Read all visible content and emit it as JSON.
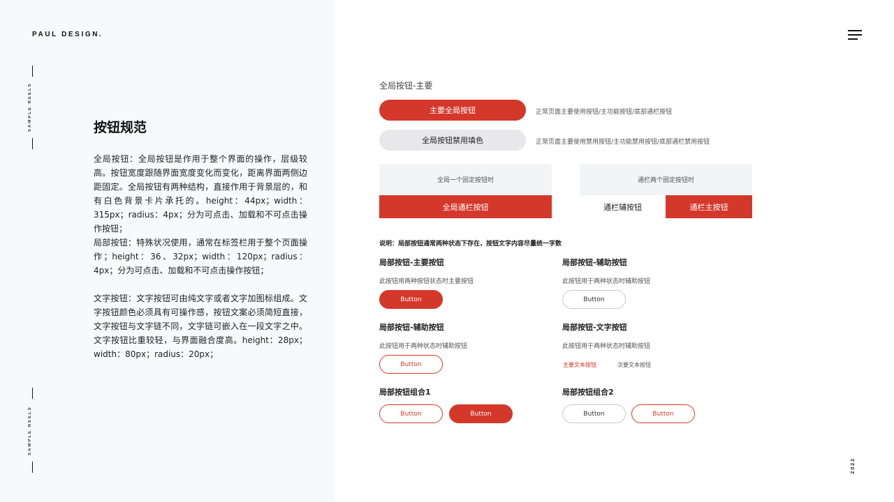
{
  "brand": "PAUL DESIGN.",
  "reel_text": "SAMPLE REELS",
  "year": "2022",
  "left": {
    "title": "按钮规范",
    "paragraphs": [
      "全局按钮：全局按钮是作用于整个界面的操作，层级较高。按钮宽度跟随界面宽度变化而变化，距离界面两侧边距固定。全局按钮有两种结构，直接作用于背景层的，和有白色背景卡片承托的。height：44px；width：315px；radius：4px；分为可点击、加载和不可点击操作按钮；",
      "局部按钮：特殊状况使用，通常在标签栏用于整个页面操作；height：36、32px；width：120px；radius：4px；分为可点击、加载和不可点击操作按钮；",
      "文字按钮：文字按钮可由纯文字或者文字加图标组成。文字按钮颜色必须具有可操作感，按钮文案必须简短直接，文字按钮与文字链不同，文字链可嵌入在一段文字之中。文字按钮比重较轻，与界面融合度高。height：28px；width：80px；radius：20px；"
    ]
  },
  "global": {
    "heading": "全局按钮-主要",
    "primary_label": "主要全局按钮",
    "primary_hint": "正常页面主要使用按钮/主功能按钮/底部通栏按钮",
    "disabled_label": "全局按钮禁用填色",
    "disabled_hint": "正常页面主要使用禁用按钮/主功能禁用按钮/底部通栏禁用按钮",
    "bar_single": {
      "caption": "全局一个固定按钮时",
      "button": "全局通栏按钮"
    },
    "bar_double": {
      "caption": "通栏两个固定按钮时",
      "secondary": "通栏辅按钮",
      "primary": "通栏主按钮"
    }
  },
  "note": "说明：局部按钮通常两种状态下存在，按钮文字内容尽量统一字数",
  "local": {
    "primary": {
      "title": "局部按钮-主要按钮",
      "hint": "此按钮用两种按钮状态时主要按钮",
      "button": "Button"
    },
    "aux_gray": {
      "title": "局部按钮-辅助按钮",
      "hint": "此按钮用于两种状态时辅助按钮",
      "button": "Button"
    },
    "aux_red": {
      "title": "局部按钮-辅助按钮",
      "hint": "此按钮用于两种状态时辅助按钮",
      "button": "Button"
    },
    "text": {
      "title": "局部按钮-文字按钮",
      "hint": "此按钮用于两种状态时辅助按钮",
      "primary_text": "主要文本按钮",
      "secondary_text": "次要文本按钮"
    },
    "combo1": {
      "title": "局部按钮组合1",
      "button_a": "Button",
      "button_b": "Button"
    },
    "combo2": {
      "title": "局部按钮组合2",
      "button_a": "Button",
      "button_b": "Button"
    }
  },
  "colors": {
    "accent": "#d4382b",
    "disabled": "#e8e8ea",
    "panel": "#f8f9fc"
  },
  "icons": {
    "menu": "hamburger-menu-icon"
  }
}
